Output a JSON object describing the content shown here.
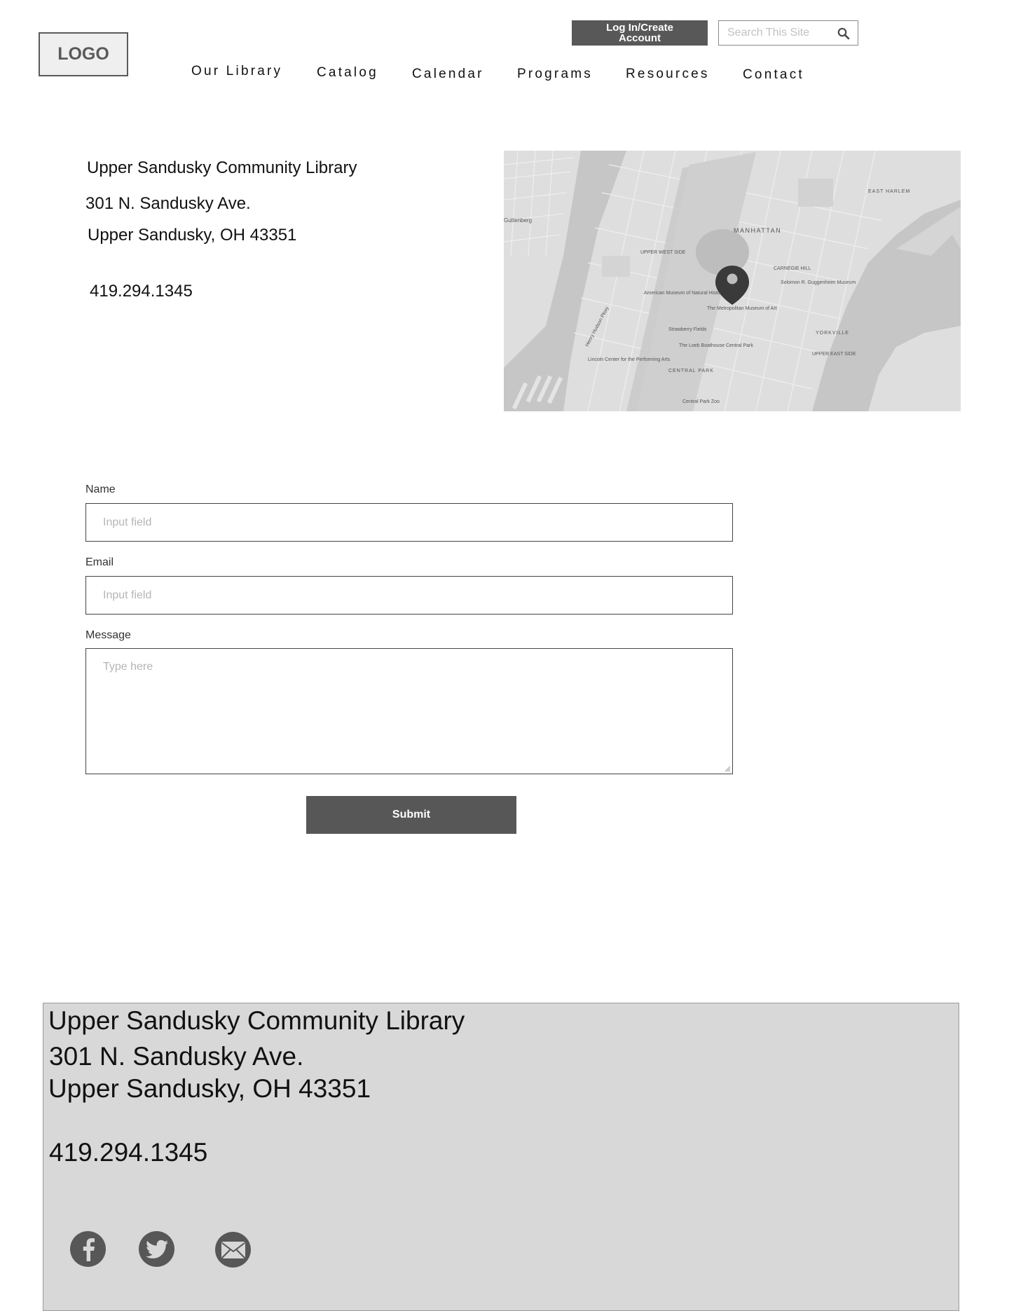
{
  "header": {
    "logo": "LOGO",
    "login_label": "Log In/Create Account",
    "search": {
      "placeholder": "Search This Site",
      "value": ""
    },
    "nav": [
      {
        "label": "Our Library"
      },
      {
        "label": "Catalog"
      },
      {
        "label": "Calendar"
      },
      {
        "label": "Programs"
      },
      {
        "label": "Resources"
      },
      {
        "label": "Contact"
      }
    ]
  },
  "contact": {
    "name": "Upper Sandusky Community Library",
    "street": "301 N. Sandusky Ave.",
    "city": "Upper Sandusky, OH 43351",
    "phone": "419.294.1345"
  },
  "map": {
    "labels": {
      "manhattan": "MANHATTAN",
      "east_harlem": "EAST HARLEM",
      "upper_west_side": "UPPER WEST SIDE",
      "upper_east_side": "UPPER EAST SIDE",
      "yorkville": "YORKVILLE",
      "central_park": "CENTRAL PARK",
      "guttenberg": "Guttenberg",
      "museum_nat_history": "American Museum of Natural History",
      "met": "The Metropolitan Museum of Art",
      "guggenheim": "Solomon R. Guggenheim Museum",
      "strawberry_fields": "Strawberry Fields",
      "loeb": "The Loeb Boathouse Central Park",
      "lincoln": "Lincoln Center for the Performing Arts",
      "zoo": "Central Park Zoo",
      "hudson_pkwy": "Henry Hudson Pkwy",
      "carnegie_hill": "CARNEGIE HILL"
    }
  },
  "form": {
    "name_label": "Name",
    "name_placeholder": "Input field",
    "email_label": "Email",
    "email_placeholder": "Input field",
    "message_label": "Message",
    "message_placeholder": "Type here",
    "submit_label": "Submit"
  },
  "footer": {
    "name": "Upper Sandusky Community Library",
    "street": "301 N. Sandusky Ave.",
    "city": "Upper Sandusky, OH 43351",
    "phone": "419.294.1345",
    "social": [
      {
        "icon": "facebook-icon"
      },
      {
        "icon": "twitter-icon"
      },
      {
        "icon": "email-icon"
      }
    ]
  },
  "colors": {
    "button": "#585858",
    "footer_bg": "#d8d8d8",
    "map_pin": "#3a3a3a"
  }
}
